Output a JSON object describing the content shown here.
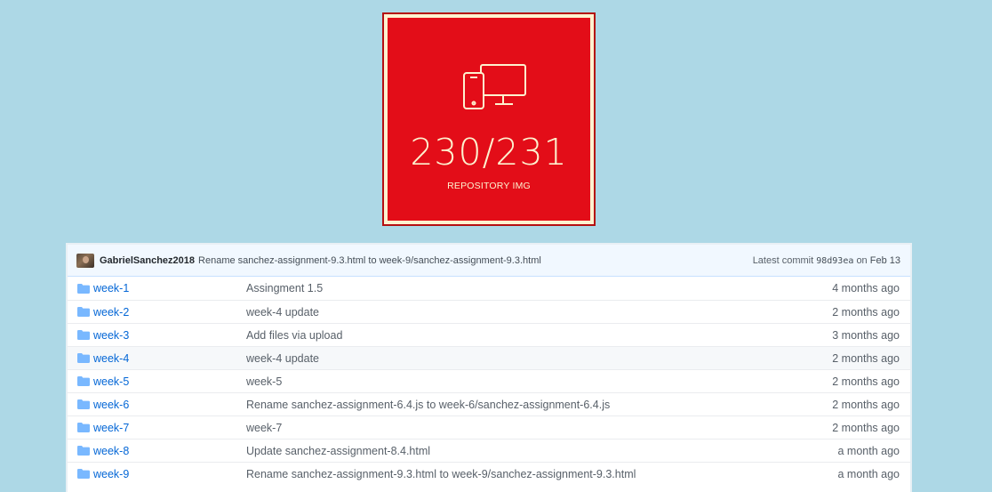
{
  "badge": {
    "icon": "devices-icon",
    "count": "230/231",
    "caption": "REPOSITORY IMG",
    "colors": {
      "background": "#e30d18",
      "foreground": "#fdf2cf"
    }
  },
  "commit_bar": {
    "author": "GabrielSanchez2018",
    "message": "Rename sanchez-assignment-9.3.html to week-9/sanchez-assignment-9.3.html",
    "latest_label": "Latest commit",
    "sha": "98d93ea",
    "on_label": "on",
    "date": "Feb 13"
  },
  "files": [
    {
      "name": "week-1",
      "message": "Assingment 1.5",
      "age": "4 months ago"
    },
    {
      "name": "week-2",
      "message": "week-4 update",
      "age": "2 months ago"
    },
    {
      "name": "week-3",
      "message": "Add files via upload",
      "age": "3 months ago"
    },
    {
      "name": "week-4",
      "message": "week-4 update",
      "age": "2 months ago"
    },
    {
      "name": "week-5",
      "message": "week-5",
      "age": "2 months ago"
    },
    {
      "name": "week-6",
      "message": "Rename sanchez-assignment-6.4.js to week-6/sanchez-assignment-6.4.js",
      "age": "2 months ago"
    },
    {
      "name": "week-7",
      "message": "week-7",
      "age": "2 months ago"
    },
    {
      "name": "week-8",
      "message": "Update sanchez-assignment-8.4.html",
      "age": "a month ago"
    },
    {
      "name": "week-9",
      "message": "Rename sanchez-assignment-9.3.html to week-9/sanchez-assignment-9.3.html",
      "age": "a month ago"
    }
  ],
  "colors": {
    "page_background": "#add8e6",
    "link": "#0366d6",
    "folder": "#79b8ff"
  }
}
